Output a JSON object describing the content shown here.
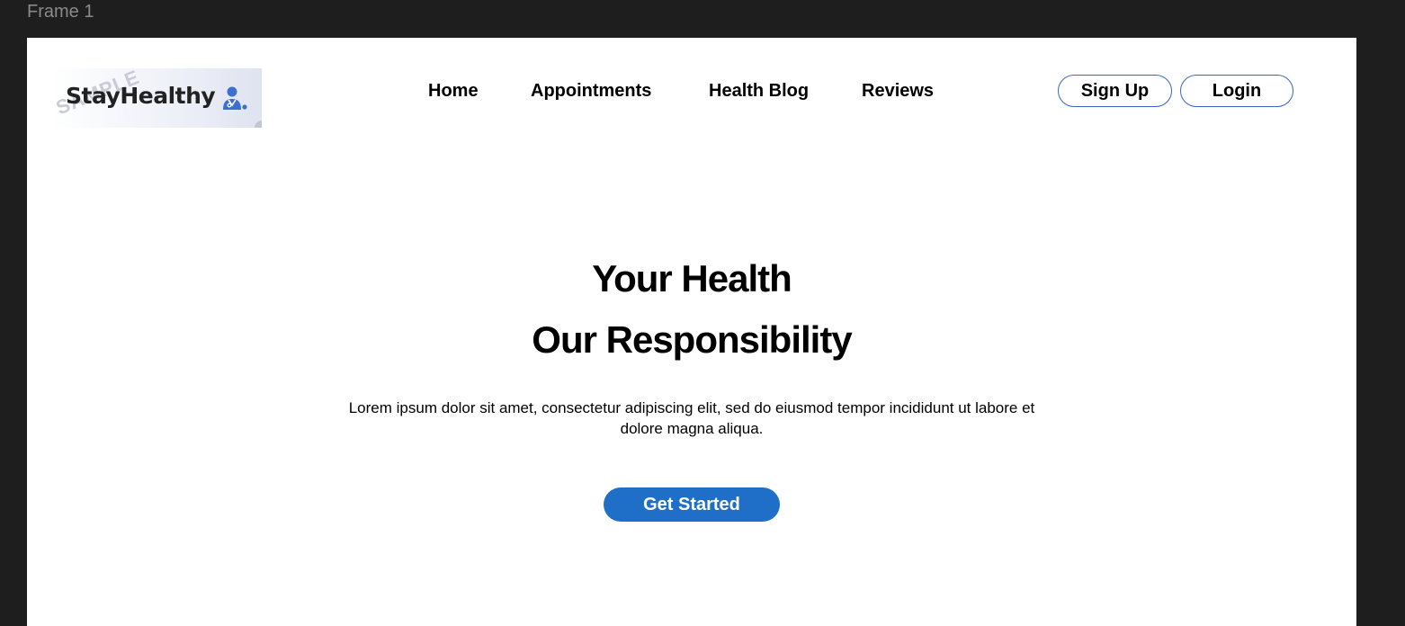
{
  "canvas": {
    "frame_label": "Frame 1"
  },
  "logo": {
    "text": "StayHealthy",
    "watermark": "SAMPLE",
    "icon": "doctor-icon"
  },
  "nav": {
    "items": [
      {
        "label": "Home"
      },
      {
        "label": "Appointments"
      },
      {
        "label": "Health Blog"
      },
      {
        "label": "Reviews"
      }
    ]
  },
  "auth": {
    "signup_label": "Sign Up",
    "login_label": "Login"
  },
  "hero": {
    "title_line1": "Your Health",
    "title_line2": "Our Responsibility",
    "body": "Lorem ipsum dolor sit amet, consectetur adipiscing elit, sed do eiusmod tempor incididunt ut labore et dolore magna aliqua.",
    "cta_label": "Get Started"
  },
  "colors": {
    "canvas_bg": "#1e1e1e",
    "frame_bg": "#ffffff",
    "accent": "#1f6fc9",
    "button_border": "#3f62c8"
  }
}
